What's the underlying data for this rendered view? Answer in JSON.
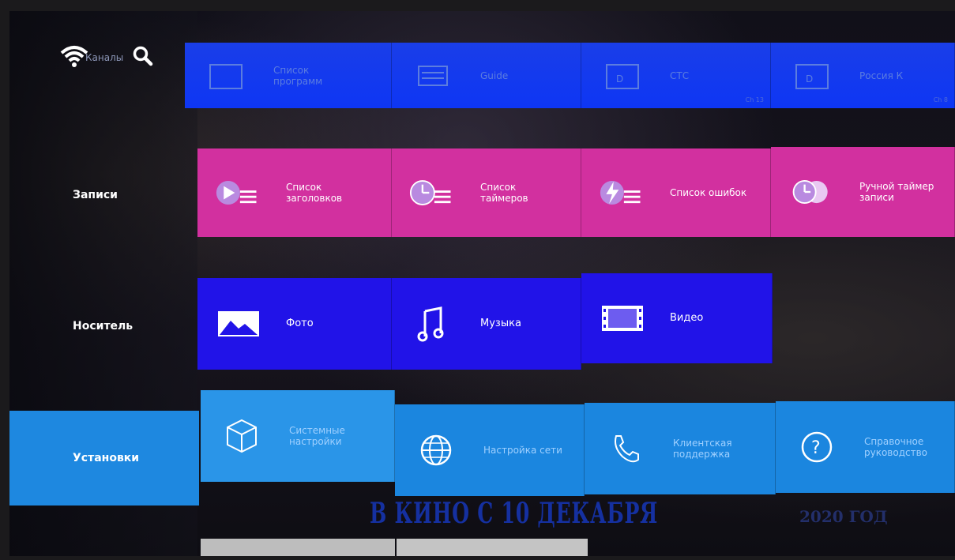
{
  "status": {
    "channels_label": "Каналы",
    "icons": [
      "wifi-icon",
      "search-icon"
    ]
  },
  "sidebar": {
    "items": [
      {
        "label": "Записи"
      },
      {
        "label": "Носитель"
      },
      {
        "label": "Установки",
        "active": true
      }
    ]
  },
  "rows": {
    "top": [
      {
        "label": "Список программ",
        "icon": "tv-guide-icon",
        "channel": ""
      },
      {
        "label": "Guide",
        "icon": "guide-icon",
        "channel": ""
      },
      {
        "label": "СТС",
        "icon": "channel-icon",
        "channel": "Ch 13"
      },
      {
        "label": "Россия К",
        "icon": "channel-icon",
        "channel": "Ch 8"
      }
    ],
    "recordings": [
      {
        "label": "Список заголовков",
        "icon": "play-list-icon"
      },
      {
        "label": "Список таймеров",
        "icon": "timer-list-icon"
      },
      {
        "label": "Список ошибок",
        "icon": "error-list-icon"
      },
      {
        "label": "Ручной таймер записи",
        "icon": "manual-timer-icon"
      }
    ],
    "media": [
      {
        "label": "Фото",
        "icon": "photo-icon"
      },
      {
        "label": "Музыка",
        "icon": "music-icon"
      },
      {
        "label": "Видео",
        "icon": "video-icon"
      }
    ],
    "settings": [
      {
        "label": "Системные настройки",
        "icon": "cube-icon"
      },
      {
        "label": "Настройка сети",
        "icon": "globe-icon"
      },
      {
        "label": "Клиентская поддержка",
        "icon": "phone-icon"
      },
      {
        "label": "Справочное руководство",
        "icon": "help-icon"
      }
    ]
  },
  "background": {
    "banner": "В КИНО С 10 ДЕКАБРЯ",
    "year": "2020 ГОД"
  },
  "colors": {
    "recordings": "#d2309f",
    "media": "#2113e8",
    "settings": "#1b86df",
    "top": "#0e36f4"
  }
}
